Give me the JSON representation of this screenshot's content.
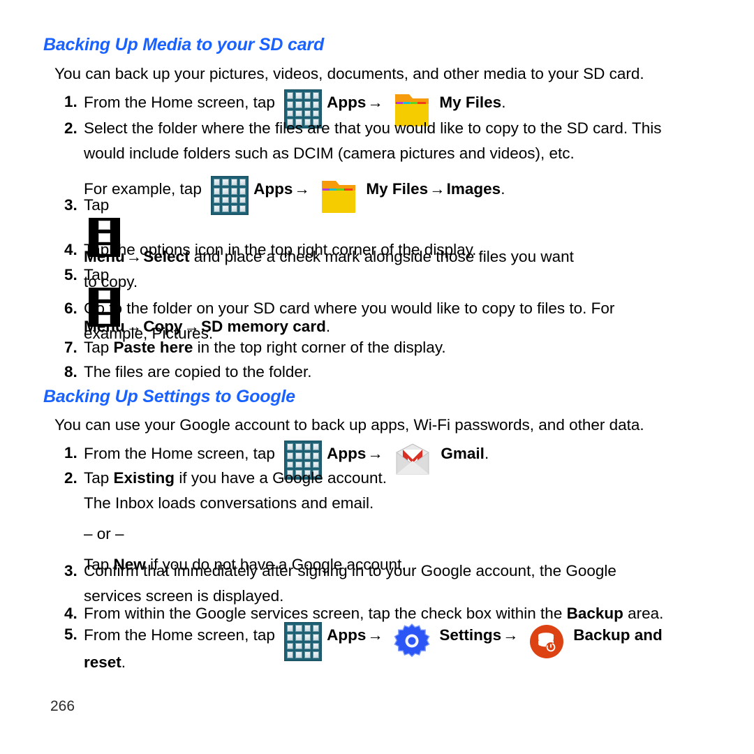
{
  "page": {
    "number": "266"
  },
  "sections": [
    {
      "heading": "Backing Up Media to your SD card",
      "intro": "You can back up your pictures, videos, documents, and other media to your SD card.",
      "steps": [
        {
          "num": "1.",
          "pre": "From the Home screen, tap",
          "icon1": "apps-icon",
          "label1": "Apps",
          "arrow1": "→",
          "icon2": "folder-icon",
          "label2": "My Files",
          "post": "."
        },
        {
          "num": "2.",
          "line1": "Select the folder where the files are that you would like to copy to the SD card. This",
          "line2": "would include folders such as DCIM (camera pictures and videos), etc.",
          "line3_pre": "For example, tap",
          "icon1": "apps-icon",
          "label1": "Apps",
          "arrow1": "→",
          "icon2": "folder-icon",
          "label2": "My Files",
          "arrow2": "→",
          "label3": "Images",
          "post": "."
        },
        {
          "num": "3.",
          "pre": "Tap",
          "icon1": "menu-icon",
          "label1": "Menu",
          "arrow1": "→",
          "label2": "Select",
          "mid": " and place a check mark alongside those files you want",
          "line2": "to copy."
        },
        {
          "num": "4.",
          "line1": "Tap the options icon in the top right corner of the display."
        },
        {
          "num": "5.",
          "pre": "Tap",
          "icon1": "menu-icon",
          "label1": "Menu",
          "arrow1": "→",
          "label2": "Copy",
          "arrow2": "→",
          "label3": "SD memory card",
          "post": "."
        },
        {
          "num": "6.",
          "line1": "Go to the folder on your SD card where you would like to copy to files to. For",
          "line2": "example, Pictures."
        },
        {
          "num": "7.",
          "pre": "Tap ",
          "label1": "Paste here",
          "mid": " in the top right corner of the display."
        },
        {
          "num": "8.",
          "line1": "The files are copied to the folder."
        }
      ]
    },
    {
      "heading": "Backing Up Settings to Google",
      "intro": "You can use your Google account to back up apps, Wi-Fi passwords, and other data.",
      "steps": [
        {
          "num": "1.",
          "pre": "From the Home screen, tap",
          "icon1": "apps-icon",
          "label1": "Apps",
          "arrow1": "→",
          "icon2": "gmail-icon",
          "label2": "Gmail",
          "post": "."
        },
        {
          "num": "2.",
          "pre": "Tap ",
          "label1": "Existing",
          "mid": " if you have a Google account.",
          "line2": "The Inbox loads conversations and email.",
          "line3": "– or –",
          "line4_pre": "Tap ",
          "label2": "New",
          "line4_post": " if you do not have a Google account."
        },
        {
          "num": "3.",
          "line1": "Confirm that immediately after signing in to your Google account, the Google",
          "line2": "services screen is displayed."
        },
        {
          "num": "4.",
          "pre": "From within the Google services screen, tap the check box within the ",
          "label1": "Backup",
          "mid": " area."
        },
        {
          "num": "5.",
          "pre": "From the Home screen, tap",
          "icon1": "apps-icon",
          "label1": "Apps",
          "arrow1": "→",
          "icon2": "gear-icon",
          "label2": "Settings",
          "arrow2": "→",
          "icon3": "backup-icon",
          "label3": "Backup and",
          "line2": "reset",
          "post": "."
        }
      ]
    }
  ],
  "colors": {
    "heading_blue": "#1a62ff",
    "apps_icon_bg": "#1d5f73",
    "folder_body": "#f5cc00",
    "folder_tab": "#f59b0c",
    "gmail_red": "#d93025",
    "gear_blue": "#2b55f5",
    "backup_orange": "#dd4213"
  }
}
